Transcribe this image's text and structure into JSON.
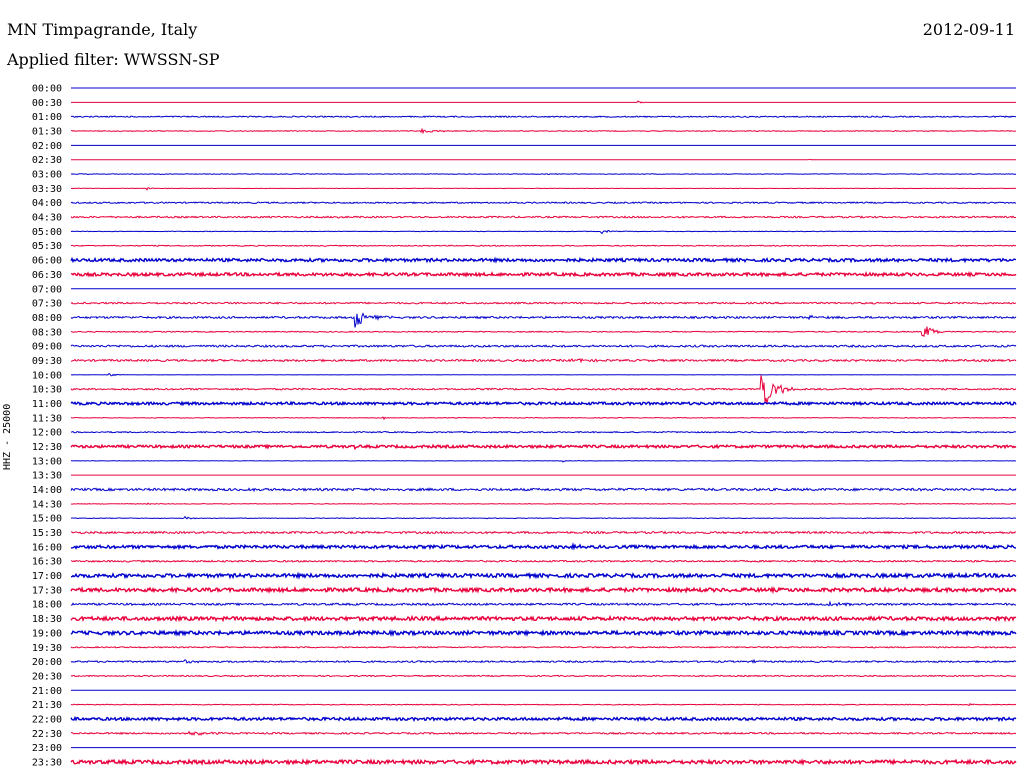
{
  "header": {
    "title": "MN Timpagrande, Italy",
    "filter": "Applied filter: WWSSN-SP",
    "date": "2012-09-11"
  },
  "chart_data": {
    "type": "line",
    "title": "MN Timpagrande, Italy",
    "subtitle": "Applied filter: WWSSN-SP",
    "ylabel": "HHZ - 25000",
    "xlabel": "",
    "colors": [
      "#0000cc",
      "#e8003c"
    ],
    "rows": [
      {
        "label": "00:00",
        "noise": 0.0,
        "events": []
      },
      {
        "label": "00:30",
        "noise": 0.0,
        "events": [
          {
            "x": 0.6,
            "amp": 2,
            "dur": 0.01
          }
        ]
      },
      {
        "label": "01:00",
        "noise": 0.6,
        "events": []
      },
      {
        "label": "01:30",
        "noise": 0.4,
        "events": [
          {
            "x": 0.37,
            "amp": 2,
            "dur": 0.06
          }
        ]
      },
      {
        "label": "02:00",
        "noise": 0.0,
        "events": []
      },
      {
        "label": "02:30",
        "noise": 0.0,
        "events": [
          {
            "x": 0.78,
            "amp": 1,
            "dur": 0.005
          }
        ]
      },
      {
        "label": "03:00",
        "noise": 0.3,
        "events": [
          {
            "x": 0.5,
            "amp": 1,
            "dur": 0.05
          }
        ]
      },
      {
        "label": "03:30",
        "noise": 0.2,
        "events": [
          {
            "x": 0.08,
            "amp": 2,
            "dur": 0.01
          }
        ]
      },
      {
        "label": "04:00",
        "noise": 0.7,
        "events": [
          {
            "x": 0.08,
            "amp": 2,
            "dur": 0.02
          }
        ]
      },
      {
        "label": "04:30",
        "noise": 0.8,
        "events": [
          {
            "x": 0.28,
            "amp": 1.5,
            "dur": 0.02
          }
        ]
      },
      {
        "label": "05:00",
        "noise": 0.3,
        "events": [
          {
            "x": 0.56,
            "amp": 3,
            "dur": 0.02
          }
        ]
      },
      {
        "label": "05:30",
        "noise": 0.5,
        "events": []
      },
      {
        "label": "06:00",
        "noise": 1.5,
        "events": []
      },
      {
        "label": "06:30",
        "noise": 1.5,
        "events": []
      },
      {
        "label": "07:00",
        "noise": 0.0,
        "events": []
      },
      {
        "label": "07:30",
        "noise": 0.8,
        "events": []
      },
      {
        "label": "08:00",
        "noise": 1.0,
        "events": [
          {
            "x": 0.3,
            "amp": 12,
            "dur": 0.04
          },
          {
            "x": 0.78,
            "amp": 2,
            "dur": 0.05
          }
        ]
      },
      {
        "label": "08:30",
        "noise": 0.5,
        "events": [
          {
            "x": 0.9,
            "amp": 10,
            "dur": 0.03
          }
        ]
      },
      {
        "label": "09:00",
        "noise": 1.0,
        "events": []
      },
      {
        "label": "09:30",
        "noise": 1.0,
        "events": [
          {
            "x": 0.53,
            "amp": 2,
            "dur": 0.05
          }
        ]
      },
      {
        "label": "10:00",
        "noise": 0.1,
        "events": [
          {
            "x": 0.04,
            "amp": 2,
            "dur": 0.02
          }
        ]
      },
      {
        "label": "10:30",
        "noise": 0.8,
        "events": [
          {
            "x": 0.73,
            "amp": 26,
            "dur": 0.04
          }
        ]
      },
      {
        "label": "11:00",
        "noise": 1.3,
        "events": []
      },
      {
        "label": "11:30",
        "noise": 0.3,
        "events": [
          {
            "x": 0.33,
            "amp": 2,
            "dur": 0.01
          }
        ]
      },
      {
        "label": "12:00",
        "noise": 0.6,
        "events": []
      },
      {
        "label": "12:30",
        "noise": 1.3,
        "events": [
          {
            "x": 0.3,
            "amp": 2,
            "dur": 0.01
          }
        ]
      },
      {
        "label": "13:00",
        "noise": 0.2,
        "events": [
          {
            "x": 0.52,
            "amp": 1.5,
            "dur": 0.01
          }
        ]
      },
      {
        "label": "13:30",
        "noise": 0.0,
        "events": []
      },
      {
        "label": "14:00",
        "noise": 1.2,
        "events": [
          {
            "x": 0.19,
            "amp": 3,
            "dur": 0.01
          }
        ]
      },
      {
        "label": "14:30",
        "noise": 0.3,
        "events": [
          {
            "x": 0.08,
            "amp": 1,
            "dur": 0.02
          }
        ]
      },
      {
        "label": "15:00",
        "noise": 0.3,
        "events": [
          {
            "x": 0.12,
            "amp": 2,
            "dur": 0.02
          },
          {
            "x": 0.44,
            "amp": 1,
            "dur": 0.005
          }
        ]
      },
      {
        "label": "15:30",
        "noise": 1.0,
        "events": []
      },
      {
        "label": "16:00",
        "noise": 1.5,
        "events": [
          {
            "x": 0.53,
            "amp": 3,
            "dur": 0.02
          }
        ]
      },
      {
        "label": "16:30",
        "noise": 0.8,
        "events": []
      },
      {
        "label": "17:00",
        "noise": 1.8,
        "events": []
      },
      {
        "label": "17:30",
        "noise": 1.8,
        "events": []
      },
      {
        "label": "18:00",
        "noise": 1.0,
        "events": [
          {
            "x": 0.8,
            "amp": 1.5,
            "dur": 0.15
          }
        ]
      },
      {
        "label": "18:30",
        "noise": 1.8,
        "events": []
      },
      {
        "label": "19:00",
        "noise": 1.8,
        "events": []
      },
      {
        "label": "19:30",
        "noise": 0.6,
        "events": []
      },
      {
        "label": "20:00",
        "noise": 0.8,
        "events": [
          {
            "x": 0.12,
            "amp": 1.5,
            "dur": 0.06
          },
          {
            "x": 0.72,
            "amp": 2,
            "dur": 0.01
          }
        ]
      },
      {
        "label": "20:30",
        "noise": 0.6,
        "events": []
      },
      {
        "label": "21:00",
        "noise": 0.0,
        "events": []
      },
      {
        "label": "21:30",
        "noise": 0.4,
        "events": [
          {
            "x": 0.95,
            "amp": 1.5,
            "dur": 0.03
          }
        ]
      },
      {
        "label": "22:00",
        "noise": 1.4,
        "events": []
      },
      {
        "label": "22:30",
        "noise": 0.8,
        "events": [
          {
            "x": 0.12,
            "amp": 4,
            "dur": 0.05
          }
        ]
      },
      {
        "label": "23:00",
        "noise": 0.0,
        "events": []
      },
      {
        "label": "23:30",
        "noise": 1.8,
        "events": []
      }
    ]
  }
}
